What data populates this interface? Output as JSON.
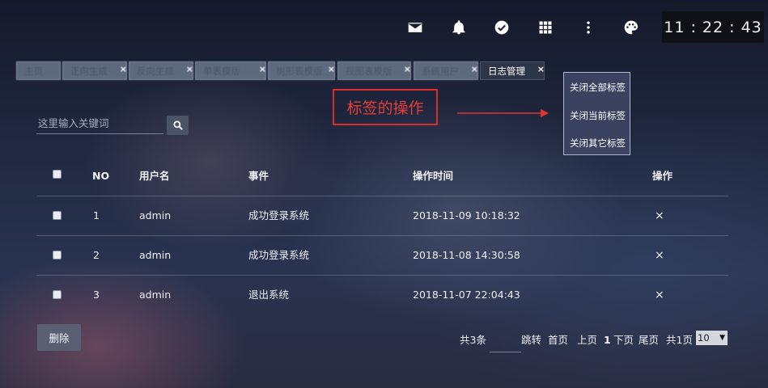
{
  "clock": "11 : 22 : 43",
  "toolbar": {
    "icons": [
      "mail-icon",
      "bell-icon",
      "check-circle-icon",
      "apps-grid-icon",
      "more-vert-icon",
      "palette-icon"
    ]
  },
  "tabs": [
    {
      "label": "主页",
      "closable": false
    },
    {
      "label": "正向生成",
      "closable": true
    },
    {
      "label": "反向生成",
      "closable": true
    },
    {
      "label": "单表模版",
      "closable": true
    },
    {
      "label": "树形表模版",
      "closable": true
    },
    {
      "label": "视图表模版",
      "closable": true
    },
    {
      "label": "系统用户",
      "closable": true
    },
    {
      "label": "日志管理",
      "closable": true,
      "active": true
    }
  ],
  "close_symbol": "×",
  "context_menu": {
    "close_all": "关闭全部标签",
    "close_current": "关闭当前标签",
    "close_others": "关闭其它标签"
  },
  "annotation": {
    "text": "标签的操作",
    "color": "#d7302c"
  },
  "search": {
    "placeholder": "这里输入关键词",
    "value": ""
  },
  "table": {
    "headers": {
      "no": "NO",
      "username": "用户名",
      "event": "事件",
      "time": "操作时间",
      "action": "操作"
    },
    "rows": [
      {
        "no": "1",
        "username": "admin",
        "event": "成功登录系统",
        "time": "2018-11-09 10:18:32",
        "action": "×"
      },
      {
        "no": "2",
        "username": "admin",
        "event": "成功登录系统",
        "time": "2018-11-08 14:30:58",
        "action": "×"
      },
      {
        "no": "3",
        "username": "admin",
        "event": "退出系统",
        "time": "2018-11-07 22:04:43",
        "action": "×"
      }
    ]
  },
  "delete_button": "删除",
  "pagination": {
    "total": "共3条",
    "jump": "跳转",
    "first": "首页",
    "prev": "上页",
    "current": "1",
    "next": "下页",
    "last": "尾页",
    "pages": "共1页",
    "page_size": "10"
  }
}
